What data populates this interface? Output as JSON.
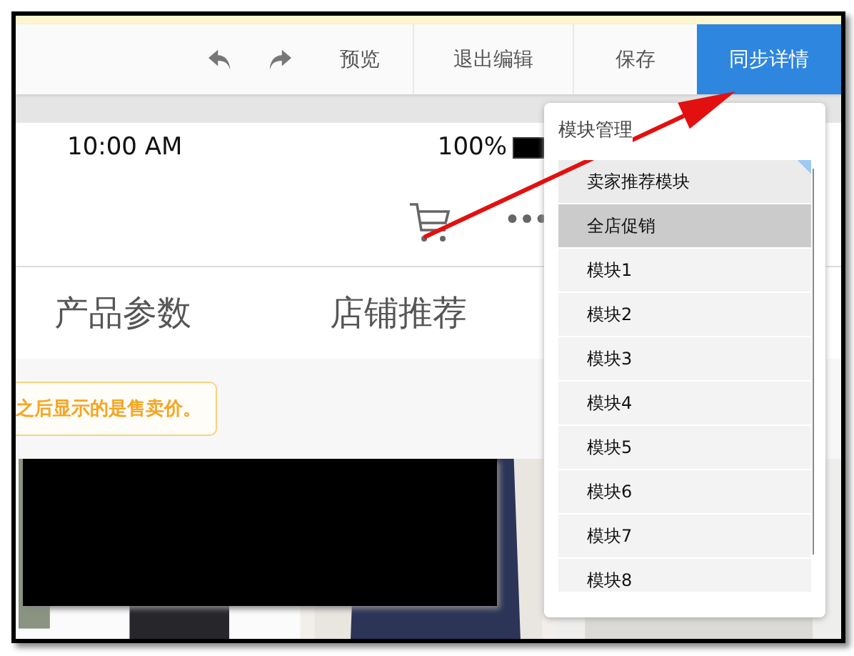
{
  "toolbar": {
    "actions": [
      {
        "label": "预览",
        "kind": "plain"
      },
      {
        "label": "退出编辑",
        "kind": "plain"
      },
      {
        "label": "保存",
        "kind": "plain"
      },
      {
        "label": "同步详情",
        "kind": "primary"
      }
    ]
  },
  "phone": {
    "status_bar": {
      "time": "10:00 AM",
      "battery": "100%"
    },
    "tabs": [
      {
        "label": "产品参数"
      },
      {
        "label": "店铺推荐"
      }
    ],
    "notice": "之后显示的是售卖价。"
  },
  "module_menu": {
    "title": "模块管理",
    "items": [
      {
        "label": "卖家推荐模块",
        "selected": false,
        "marked": true
      },
      {
        "label": "全店促销",
        "selected": true,
        "marked": false
      },
      {
        "label": "模块1",
        "selected": false,
        "marked": false
      },
      {
        "label": "模块2",
        "selected": false,
        "marked": false
      },
      {
        "label": "模块3",
        "selected": false,
        "marked": false
      },
      {
        "label": "模块4",
        "selected": false,
        "marked": false
      },
      {
        "label": "模块5",
        "selected": false,
        "marked": false
      },
      {
        "label": "模块6",
        "selected": false,
        "marked": false
      },
      {
        "label": "模块7",
        "selected": false,
        "marked": false
      },
      {
        "label": "模块8",
        "selected": false,
        "marked": false
      }
    ]
  }
}
